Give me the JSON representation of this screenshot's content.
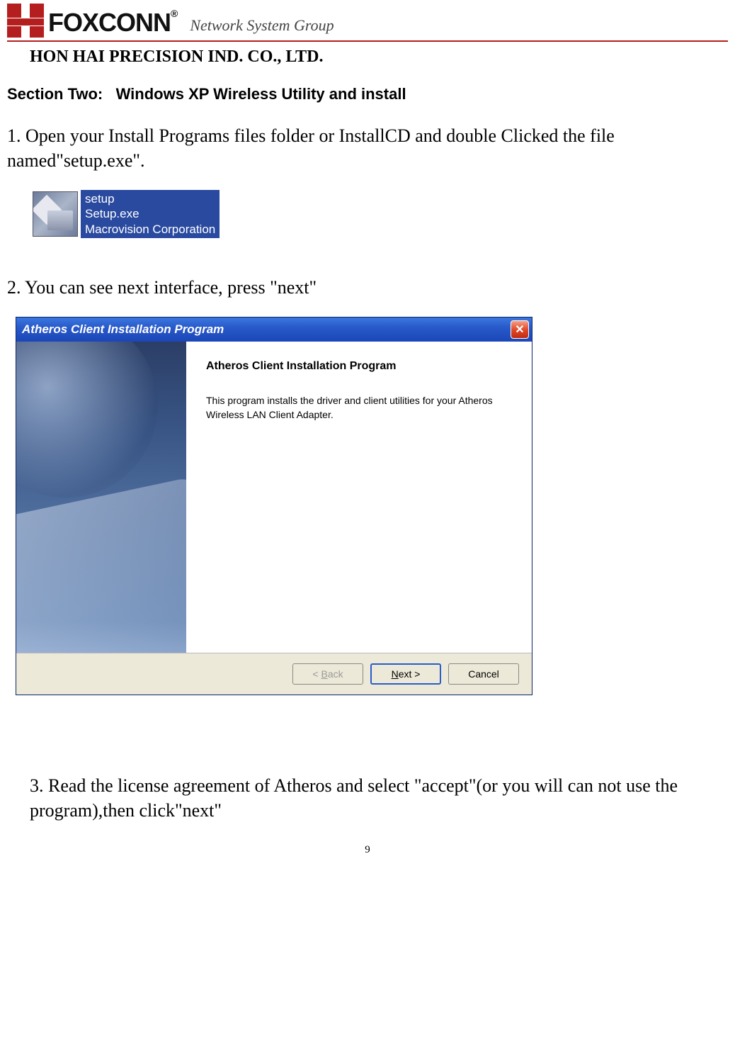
{
  "header": {
    "brand": "FOXCONN",
    "registered": "®",
    "subtitle": "Network System Group",
    "company": "HON HAI PRECISION IND. CO., LTD."
  },
  "section": {
    "label": "Section Two:",
    "title": "Windows XP Wireless Utility and install"
  },
  "steps": {
    "s1": "1.  Open your Install Programs files folder or InstallCD and double Clicked the file named\"setup.exe\".",
    "s2": "2.  You can see next interface, press \"next\"",
    "s3": "3.  Read the license agreement of Atheros and select \"accept\"(or you will can not use the program),then click\"next\""
  },
  "setup_file": {
    "line1": "setup",
    "line2": "Setup.exe",
    "line3": "Macrovision Corporation"
  },
  "installer": {
    "title": "Atheros Client Installation Program",
    "heading": "Atheros Client Installation Program",
    "description": "This program installs the driver and client utilities for your Atheros Wireless LAN Client Adapter.",
    "buttons": {
      "back": "< Back",
      "next": "Next >",
      "cancel": "Cancel"
    }
  },
  "page_number": "9"
}
